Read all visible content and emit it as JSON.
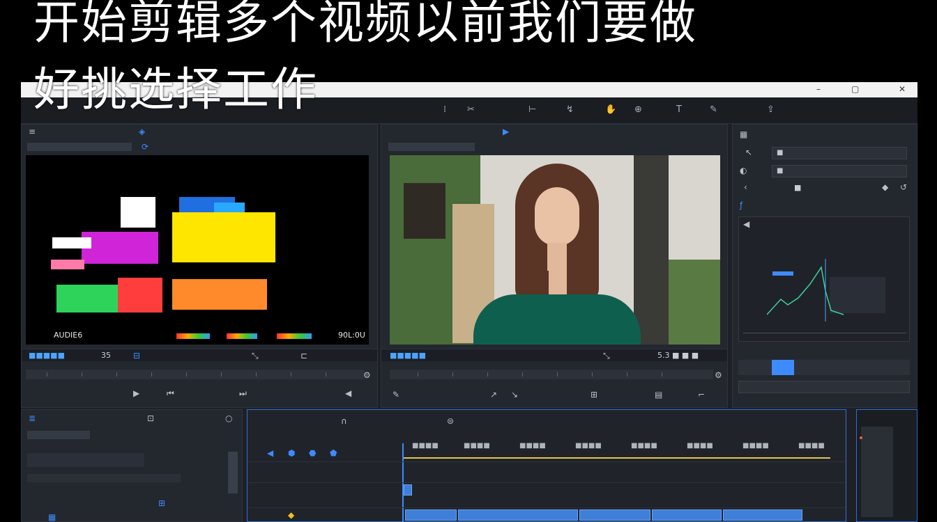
{
  "caption": {
    "line1": "开始剪辑多个视频以前我们要做",
    "line2": "好挑选择工作"
  },
  "colors": {
    "accent": "#3d8bff",
    "panel_bg": "#23272e",
    "app_bg": "#1d2127"
  },
  "icons": {
    "minimize": "minimize-icon",
    "maximize": "maximize-icon",
    "close": "close-icon",
    "play": "play-icon",
    "step_forward": "step-forward-icon"
  },
  "source_monitor": {
    "timecode_left": "AUDIE6",
    "timecode_right": "90L:0U",
    "footer_left": "■■■■■",
    "footer_num": "35"
  },
  "program_monitor": {
    "footer_right": "5.3 ■ ■ ■",
    "footer_left": "■■■■■"
  },
  "right_panel": {
    "row1": "■",
    "row2": "■",
    "row3": "■"
  },
  "timeline": {
    "ruler_labels": [
      "■■■■",
      "■■■■",
      "■■■■",
      "■■■■",
      "■■■■",
      "■■■■",
      "■■■■",
      "■■■■"
    ]
  }
}
